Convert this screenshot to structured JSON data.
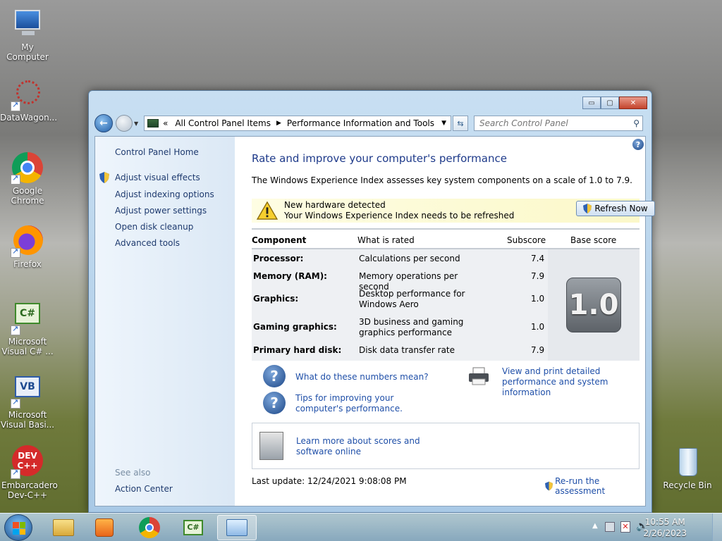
{
  "desktop": {
    "icons": [
      {
        "label": "My Computer"
      },
      {
        "label": "DataWagon..."
      },
      {
        "label": "Google Chrome"
      },
      {
        "label": "Firefox"
      },
      {
        "label": "Microsoft Visual C# ..."
      },
      {
        "label": "Microsoft Visual Basi..."
      },
      {
        "label": "Embarcadero Dev-C++"
      },
      {
        "label": "Recycle Bin"
      }
    ]
  },
  "window": {
    "controls": {
      "minimize": "▭",
      "maximize": "▢",
      "close": "✕"
    },
    "address": {
      "prefix": "«",
      "crumbs": [
        "All Control Panel Items",
        "Performance Information and Tools"
      ]
    },
    "search": {
      "placeholder": "Search Control Panel"
    }
  },
  "left_pane": {
    "home": "Control Panel Home",
    "links": [
      "Adjust visual effects",
      "Adjust indexing options",
      "Adjust power settings",
      "Open disk cleanup",
      "Advanced tools"
    ],
    "see_also": "See also",
    "see_also_links": [
      "Action Center"
    ]
  },
  "main": {
    "title": "Rate and improve your computer's performance",
    "subtitle": "The Windows Experience Index assesses key system components on a scale of 1.0 to 7.9.",
    "alert": {
      "line1": "New hardware detected",
      "line2": "Your Windows Experience Index needs to be refreshed",
      "button": "Refresh Now"
    },
    "table": {
      "headers": {
        "component": "Component",
        "rated": "What is rated",
        "subscore": "Subscore",
        "base": "Base score"
      },
      "rows": [
        {
          "component": "Processor:",
          "rated": "Calculations per second",
          "subscore": "7.4"
        },
        {
          "component": "Memory (RAM):",
          "rated": "Memory operations per second",
          "subscore": "7.9"
        },
        {
          "component": "Graphics:",
          "rated": "Desktop performance for Windows Aero",
          "subscore": "1.0"
        },
        {
          "component": "Gaming graphics:",
          "rated": "3D business and gaming graphics performance",
          "subscore": "1.0"
        },
        {
          "component": "Primary hard disk:",
          "rated": "Disk data transfer rate",
          "subscore": "7.9"
        }
      ],
      "base_score": "1.0"
    },
    "links": {
      "numbers": "What do these numbers mean?",
      "tips": "Tips for improving your computer's performance.",
      "print": "View and print detailed performance and system information",
      "learn": "Learn more about scores and software online"
    },
    "last_update": "Last update: 12/24/2021 9:08:08 PM",
    "rerun": "Re-run the assessment"
  },
  "taskbar": {
    "clock_time": "10:55 AM",
    "clock_date": "2/26/2023"
  }
}
